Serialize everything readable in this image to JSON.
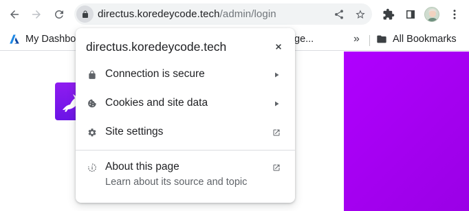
{
  "toolbar": {
    "url_host": "directus.koredeycode.tech",
    "url_path": "/admin/login",
    "icons": [
      "back-arrow-icon",
      "forward-arrow-icon",
      "reload-icon",
      "lock-icon",
      "share-icon",
      "star-icon",
      "extensions-icon",
      "side-panel-icon",
      "avatar",
      "more-vert-icon"
    ]
  },
  "bookmarks": {
    "items": [
      {
        "label": "My Dashbo",
        "icon": "azure-icon"
      },
      {
        "label": "ge...",
        "icon": ""
      }
    ],
    "overflow": "»",
    "all_bookmarks": "All Bookmarks"
  },
  "popup": {
    "title": "directus.koredeycode.tech",
    "rows": [
      {
        "label": "Connection is secure",
        "icon": "lock-icon",
        "trail": "arrow-right-icon"
      },
      {
        "label": "Cookies and site data",
        "icon": "cookie-icon",
        "trail": "arrow-right-icon"
      },
      {
        "label": "Site settings",
        "icon": "gear-icon",
        "trail": "open-in-new-icon"
      },
      {
        "label": "About this page",
        "icon": "about-page-icon",
        "trail": "open-in-new-icon"
      }
    ],
    "about_sub": "Learn about its source and topic"
  },
  "colors": {
    "accent": "#b000ff",
    "logo": "#7f18ec"
  }
}
